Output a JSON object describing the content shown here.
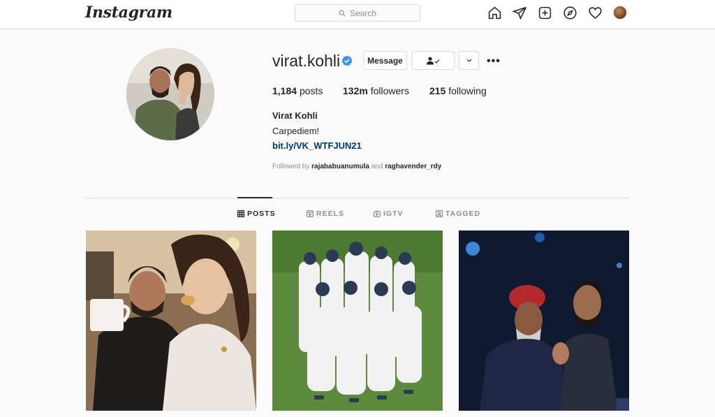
{
  "topbar": {
    "logo_text": "Instagram",
    "search_placeholder": "Search",
    "icons": [
      "home-icon",
      "direct-icon",
      "new-post-icon",
      "explore-icon",
      "activity-icon",
      "profile-avatar"
    ]
  },
  "profile": {
    "username": "virat.kohli",
    "verified": true,
    "message_label": "Message",
    "posts_count": "1,184",
    "posts_label": "posts",
    "followers_count": "132m",
    "followers_label": "followers",
    "following_count": "215",
    "following_label": "following",
    "full_name": "Virat Kohli",
    "bio": "Carpediem!",
    "link": "bit.ly/VK_WTFJUN21",
    "followed_by_prefix": "Followed by",
    "followed_by_user1": "rajababuanumula",
    "followed_by_and": "and",
    "followed_by_user2": "raghavender_rdy"
  },
  "tabs": [
    {
      "label": "POSTS",
      "active": true
    },
    {
      "label": "REELS",
      "active": false
    },
    {
      "label": "IGTV",
      "active": false
    },
    {
      "label": "TAGGED",
      "active": false
    }
  ],
  "colors": {
    "verified_blue": "#3897f0",
    "link_blue": "#00376b",
    "border": "#dbdbdb",
    "background": "#fafafa"
  }
}
